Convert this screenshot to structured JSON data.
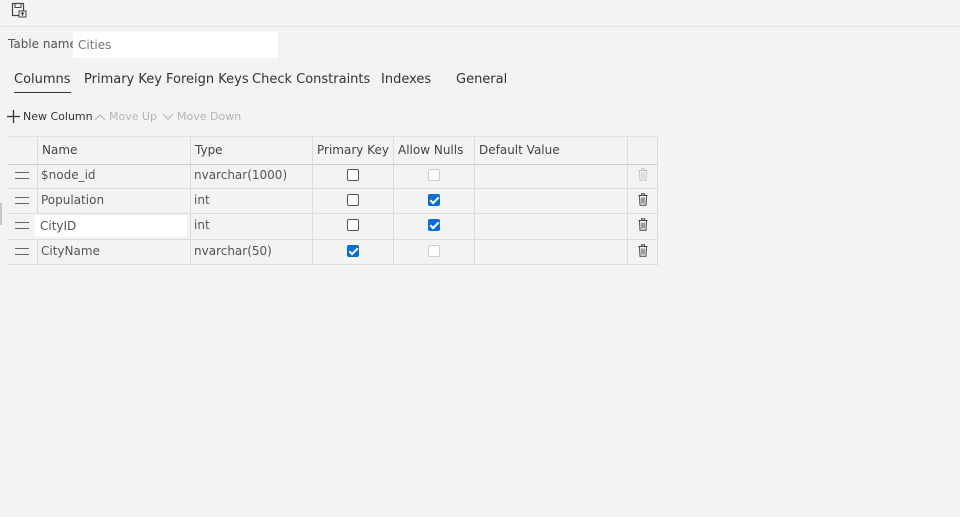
{
  "table_name": {
    "label": "Table name",
    "value": "Cities"
  },
  "tabs": [
    {
      "label": "Columns",
      "active": true
    },
    {
      "label": "Primary Key"
    },
    {
      "label": "Foreign Keys"
    },
    {
      "label": "Check Constraints"
    },
    {
      "label": "Indexes"
    },
    {
      "label": "General"
    }
  ],
  "toolbar": {
    "new_column": "New Column",
    "move_up": "Move Up",
    "move_down": "Move Down"
  },
  "grid": {
    "headers": {
      "name": "Name",
      "type": "Type",
      "primary_key": "Primary Key",
      "allow_nulls": "Allow Nulls",
      "default_value": "Default Value"
    },
    "rows": [
      {
        "name": "$node_id",
        "type": "nvarchar(1000)",
        "default": "",
        "primary_key": false,
        "allow_nulls": false,
        "allow_nulls_enabled": false,
        "delete_enabled": false,
        "editing": false
      },
      {
        "name": "Population",
        "type": "int",
        "default": "",
        "primary_key": false,
        "allow_nulls": true,
        "allow_nulls_enabled": true,
        "delete_enabled": true,
        "editing": false
      },
      {
        "name": "CityID",
        "type": "int",
        "default": "",
        "primary_key": false,
        "allow_nulls": true,
        "allow_nulls_enabled": true,
        "delete_enabled": true,
        "editing": true
      },
      {
        "name": "CityName",
        "type": "nvarchar(50)",
        "default": "",
        "primary_key": true,
        "allow_nulls": false,
        "allow_nulls_enabled": false,
        "delete_enabled": true,
        "editing": false
      }
    ]
  },
  "colors": {
    "accent": "#0a6ed1",
    "background": "#f3f3f3",
    "grid_line": "#dcdcdc"
  }
}
